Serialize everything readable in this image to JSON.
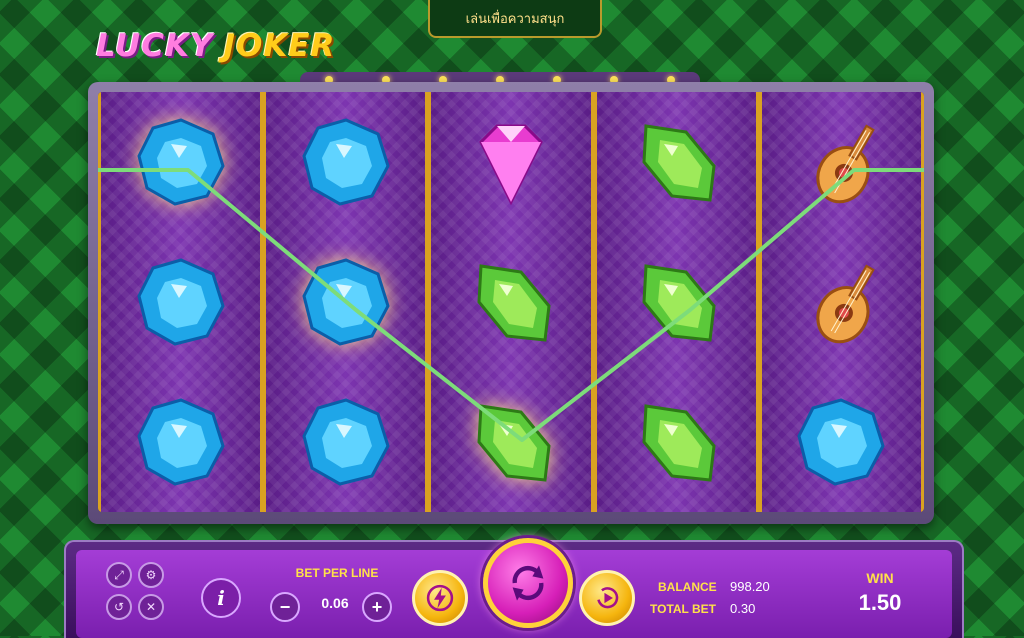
{
  "top_bar": {
    "mode_label": "เล่นเพื่อความสนุก"
  },
  "logo": {
    "word1": "LUCKY",
    "word2": "JOKER"
  },
  "reels": [
    [
      "blue-gem",
      "blue-gem",
      "blue-gem"
    ],
    [
      "blue-gem",
      "blue-gem",
      "blue-gem"
    ],
    [
      "pink-diamond",
      "green-gem",
      "green-gem"
    ],
    [
      "green-gem",
      "green-gem",
      "green-gem"
    ],
    [
      "mandolin",
      "mandolin",
      "blue-gem"
    ]
  ],
  "highlighted_symbols": [
    [
      0,
      0
    ],
    [
      1,
      1
    ],
    [
      2,
      2
    ]
  ],
  "controls": {
    "bet_per_line_label": "BET PER LINE",
    "bet_per_line_value": "0.06",
    "minus_label": "−",
    "plus_label": "+",
    "info_label": "i",
    "fullscreen_icon": "fullscreen-icon",
    "settings_icon": "gear-icon",
    "history_icon": "history-icon",
    "sound_icon": "mute-icon"
  },
  "balance": {
    "label": "BALANCE",
    "value": "998.20"
  },
  "total_bet": {
    "label": "TOTAL BET",
    "value": "0.30"
  },
  "win": {
    "label": "WIN",
    "value": "1.50"
  },
  "colors": {
    "background": "#1f8a32",
    "reel_frame": "#d9a221",
    "payline": "#7ddc7a",
    "panel": "#a43dd6",
    "label_yellow": "#ffe14a"
  }
}
